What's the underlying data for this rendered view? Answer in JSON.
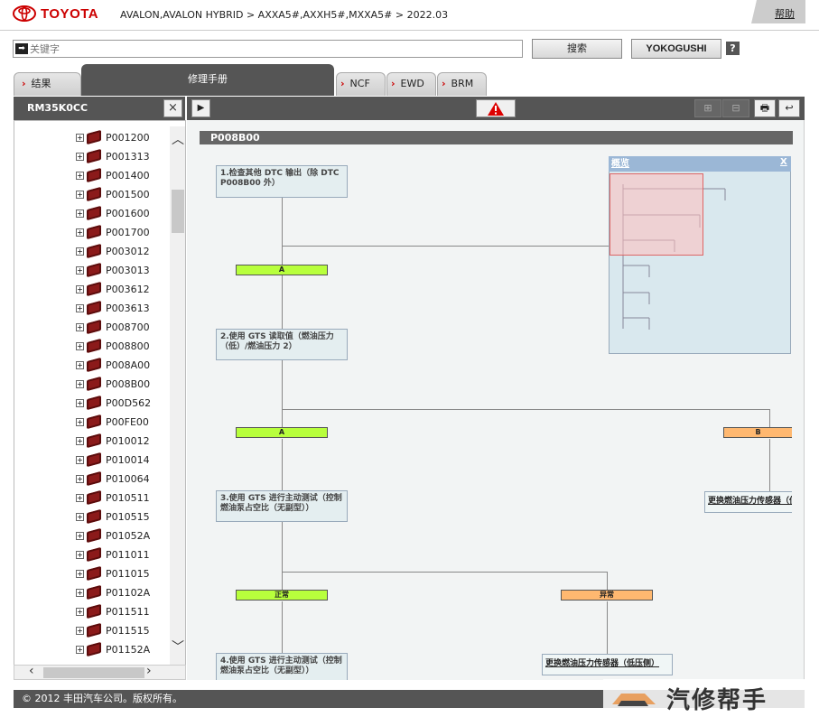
{
  "header": {
    "brand": "TOYOTA",
    "breadcrumb": "AVALON,AVALON HYBRID > AXXA5#,AXXH5#,MXXA5# > 2022.03",
    "help_label": "帮助"
  },
  "search": {
    "placeholder": "关键字",
    "search_button": "搜索",
    "yokogushi_button": "YOKOGUSHI",
    "help_q": "?"
  },
  "tabs": {
    "results": "结果",
    "manual": "修理手册",
    "ncf": "NCF",
    "ewd": "EWD",
    "brm": "BRM"
  },
  "left_panel": {
    "title": "RM35K0CC",
    "close": "×",
    "items": [
      "P001200",
      "P001313",
      "P001400",
      "P001500",
      "P001600",
      "P001700",
      "P003012",
      "P003013",
      "P003612",
      "P003613",
      "P008700",
      "P008800",
      "P008A00",
      "P008B00",
      "P00D562",
      "P00FE00",
      "P010012",
      "P010014",
      "P010064",
      "P010511",
      "P010515",
      "P01052A",
      "P011011",
      "P011015",
      "P01102A",
      "P011511",
      "P011515",
      "P01152A"
    ]
  },
  "main": {
    "doc_title": "P008B00",
    "steps": {
      "s1": "1.检查其他 DTC 输出（除 DTC P008B00 外）",
      "s2": "2.使用 GTS 读取值（燃油压力（低）/燃油压力 2）",
      "s3": "3.使用 GTS 进行主动测试（控制燃油泵占空比（无副型））",
      "s4": "4.使用 GTS 进行主动测试（控制燃油泵占空比（无副型））"
    },
    "branches": {
      "a1": "A",
      "a2": "A",
      "b2": "B",
      "normal": "正常",
      "abnormal": "异常"
    },
    "results": {
      "r_b": "更换燃油压力传感器（低",
      "r_abn": "更换燃油压力传感器（低压侧）"
    },
    "overview": {
      "title": "概览",
      "close": "X"
    }
  },
  "footer": {
    "copyright": "© 2012 丰田汽车公司。版权所有。"
  },
  "watermark": "汽修帮手",
  "colors": {
    "brand_red": "#cc0000",
    "pass_green": "#b8ff3c",
    "fail_orange": "#ffb870",
    "bar_gray": "#555555"
  }
}
